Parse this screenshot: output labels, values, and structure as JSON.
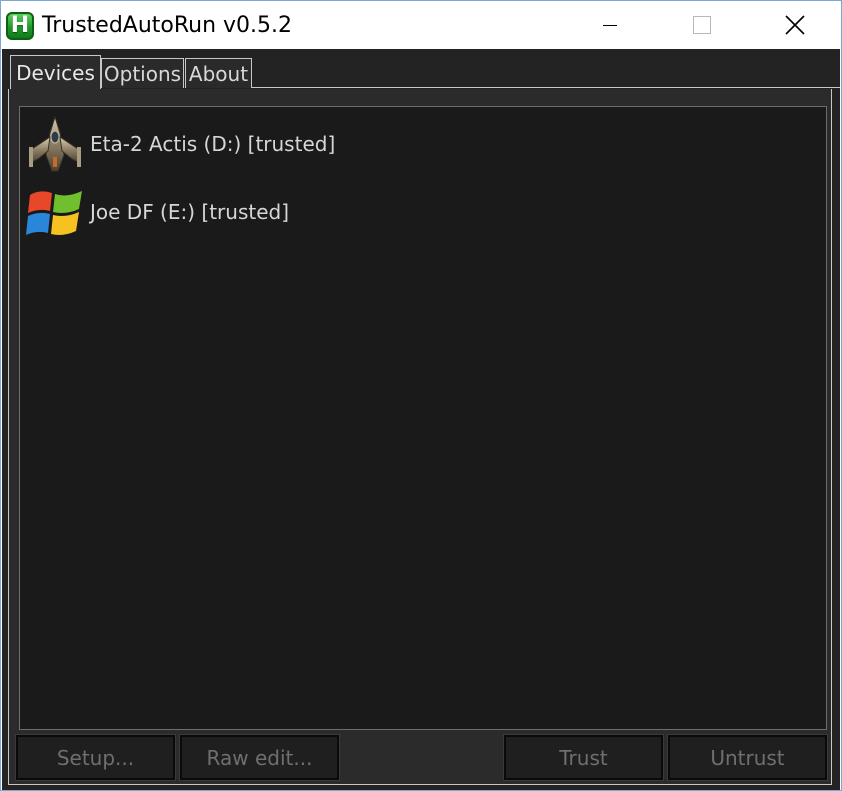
{
  "window": {
    "title": "TrustedAutoRun v0.5.2",
    "app_icon_letter": "H"
  },
  "tabs": [
    {
      "label": "Devices",
      "active": true
    },
    {
      "label": "Options",
      "active": false
    },
    {
      "label": "About",
      "active": false
    }
  ],
  "devices": [
    {
      "label": "Eta-2 Actis (D:) [trusted]",
      "icon": "starfighter-icon"
    },
    {
      "label": "Joe DF (E:) [trusted]",
      "icon": "windows-logo-icon"
    }
  ],
  "buttons": {
    "setup": "Setup...",
    "raw_edit": "Raw edit...",
    "trust": "Trust",
    "untrust": "Untrust"
  },
  "colors": {
    "background": "#232323",
    "list_background": "#1a1a1a",
    "text": "#d6d6d6",
    "disabled_text": "#6f6f6f",
    "app_icon_green": "#1f9a2a"
  }
}
